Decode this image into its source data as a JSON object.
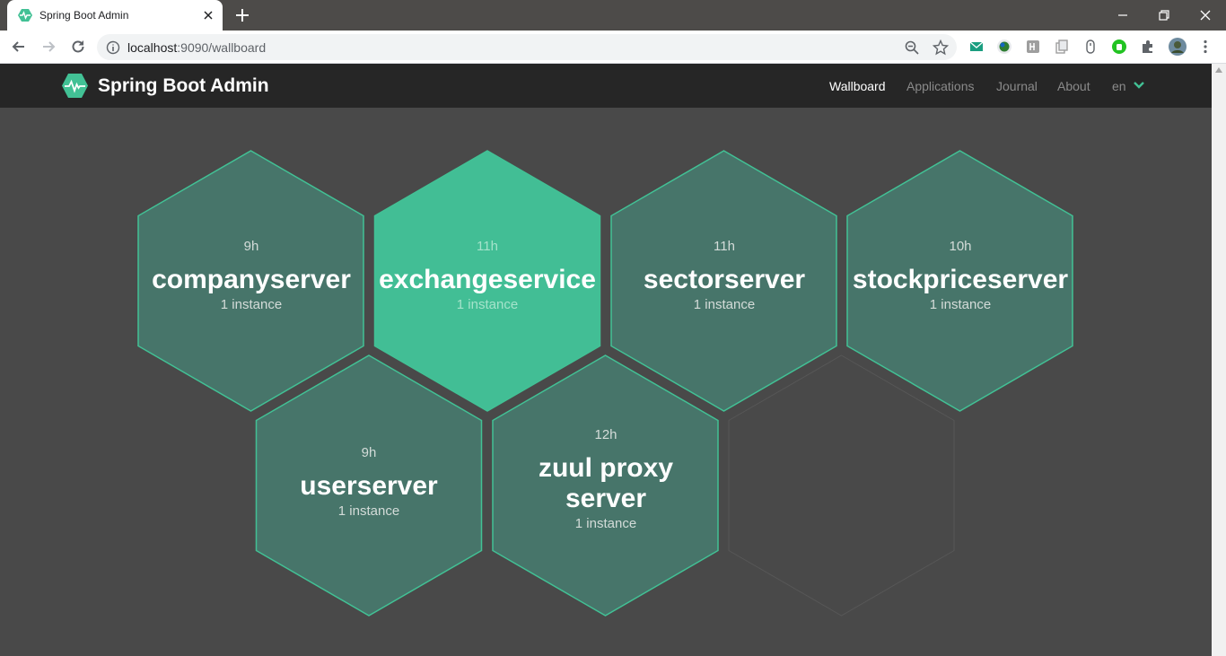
{
  "browser": {
    "tab_title": "Spring Boot Admin",
    "url_host": "localhost",
    "url_rest": ":9090/wallboard"
  },
  "navbar": {
    "brand": "Spring Boot Admin",
    "links": {
      "wallboard": "Wallboard",
      "applications": "Applications",
      "journal": "Journal",
      "about": "About",
      "language": "en"
    },
    "accent_color": "#42c195"
  },
  "applications": [
    {
      "uptime": "9h",
      "name": "companyserver",
      "instances": "1 instance"
    },
    {
      "uptime": "11h",
      "name": "exchangeservice",
      "instances": "1 instance"
    },
    {
      "uptime": "11h",
      "name": "sectorserver",
      "instances": "1 instance"
    },
    {
      "uptime": "10h",
      "name": "stockpriceserver",
      "instances": "1 instance"
    },
    {
      "uptime": "9h",
      "name": "userserver",
      "instances": "1 instance"
    },
    {
      "uptime": "12h",
      "name": "zuul proxy",
      "name2": "server",
      "instances": "1 instance"
    }
  ],
  "colors": {
    "up_hex_fill": "#47756a",
    "highlight_hex_fill": "#42be95",
    "hex_stroke": "#42c195",
    "background": "#494949"
  }
}
